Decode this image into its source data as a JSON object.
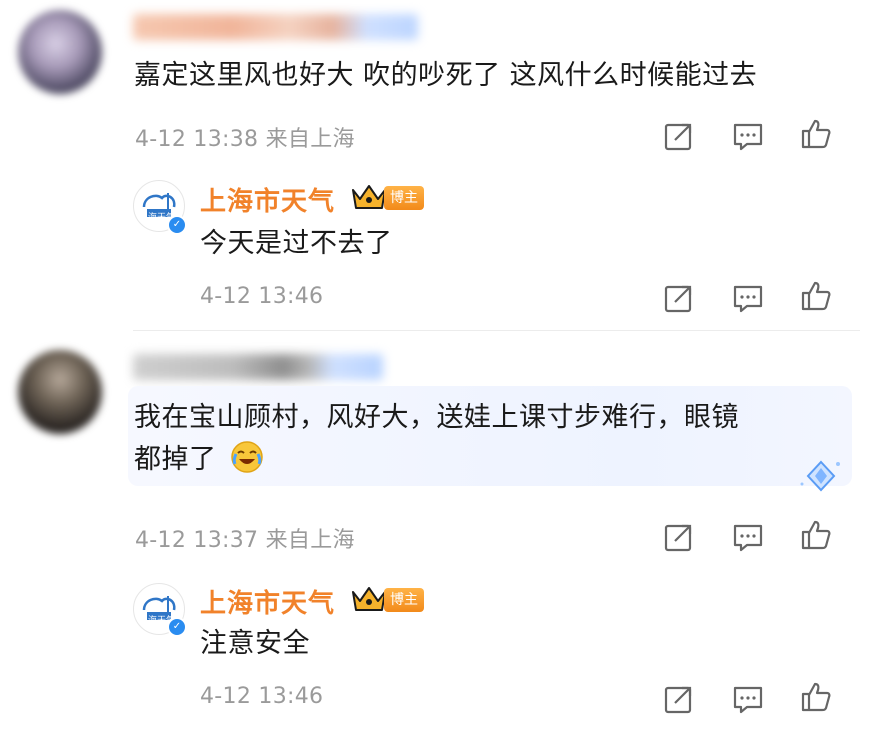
{
  "comment1": {
    "text": "嘉定这里风也好大 吹的吵死了 这风什么时候能过去",
    "meta": "4-12 13:38 来自上海"
  },
  "reply1": {
    "name": "上海市天气",
    "badge": "博主",
    "text": "今天是过不去了",
    "meta": "4-12 13:46",
    "avatar_label": "上海天气"
  },
  "comment2": {
    "text_line1": "我在宝山顾村，风好大，送娃上课寸步难行，眼镜",
    "text_line2": "都掉了",
    "meta": "4-12 13:37 来自上海"
  },
  "reply2": {
    "name": "上海市天气",
    "badge": "博主",
    "text": "注意安全",
    "meta": "4-12 13:46",
    "avatar_label": "上海天气"
  },
  "icons": {
    "share": "share-icon",
    "comment": "comment-icon",
    "like": "like-icon",
    "crown": "crown-icon",
    "emoji": "laugh-cry-emoji-icon"
  },
  "colors": {
    "accent": "#f1822a",
    "meta_text": "#9a9a9a",
    "body_text": "#1a1a1a"
  }
}
